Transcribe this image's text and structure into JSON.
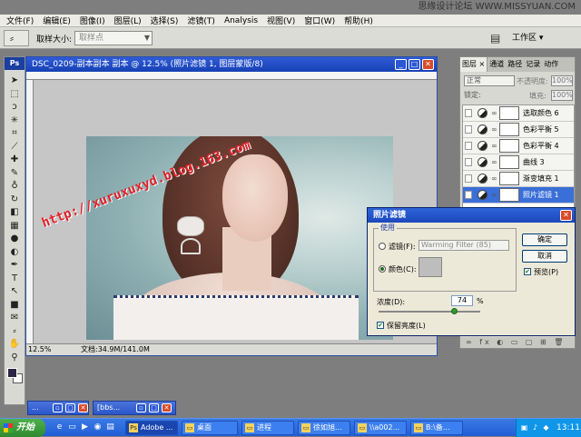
{
  "watermark_site": "思缘设计论坛 WWW.MISSYUAN.COM",
  "menubar": [
    "文件(F)",
    "编辑(E)",
    "图像(I)",
    "图层(L)",
    "选择(S)",
    "滤镜(T)",
    "Analysis",
    "视图(V)",
    "窗口(W)",
    "帮助(H)"
  ],
  "options": {
    "sample_size_label": "取样大小:",
    "sample_size_value": "取样点",
    "workspace": "工作区 ▾"
  },
  "toolbox": {
    "header": "Ps",
    "tools": [
      "move-icon",
      "marquee-icon",
      "lasso-icon",
      "magic-wand-icon",
      "crop-icon",
      "slice-icon",
      "healing-icon",
      "brush-icon",
      "stamp-icon",
      "history-brush-icon",
      "eraser-icon",
      "gradient-icon",
      "blur-icon",
      "dodge-icon",
      "pen-icon",
      "type-icon",
      "path-select-icon",
      "shape-icon",
      "notes-icon",
      "eyedropper-icon",
      "hand-icon",
      "zoom-icon"
    ],
    "glyphs": [
      "➤",
      "⬚",
      "ↄ",
      "✳",
      "⌗",
      "⟋",
      "✚",
      "✎",
      "♁",
      "↻",
      "◧",
      "▦",
      "●",
      "◐",
      "✒",
      "T",
      "↖",
      "■",
      "✉",
      "⸗",
      "✋",
      "⚲"
    ],
    "colors": {
      "foreground": "#2d2646",
      "background": "#ffffff"
    }
  },
  "document": {
    "title": "DSC_0209-副本副本 副本 @ 12.5% (照片滤镜 1, 图层蒙版/8)",
    "zoom": "12.5%",
    "doc_size": "文档:34.9M/141.0M",
    "watermark": "http://xuruxuxyd.blog.163.com"
  },
  "layers": {
    "tabs": [
      "图层 ×",
      "通道",
      "路径",
      "记录",
      "动作"
    ],
    "blend_mode": "正常",
    "opacity_label": "不透明度:",
    "opacity_value": "100%",
    "lock_label": "锁定:",
    "fill_label": "填充:",
    "fill_value": "100%",
    "rows": [
      {
        "name": "选取颜色 6",
        "active": false
      },
      {
        "name": "色彩平衡 5",
        "active": false
      },
      {
        "name": "色彩平衡 4",
        "active": false
      },
      {
        "name": "曲线 3",
        "active": false
      },
      {
        "name": "渐变填充 1",
        "active": false
      },
      {
        "name": "照片滤镜 1",
        "active": true
      }
    ],
    "footer": "∞ fx ◐ ▭ ▢ ⊞ 🗑"
  },
  "dialog": {
    "title": "照片滤镜",
    "use_label": "使用",
    "filter_label": "滤镜(F):",
    "filter_value": "Warming Filter (85)",
    "color_label": "颜色(C):",
    "color_swatch": "#bdbdbd",
    "ok": "确定",
    "cancel": "取消",
    "preview": "预览(P)",
    "density_label": "浓度(D):",
    "density_value": "74",
    "density_unit": "%",
    "density_level": 0.74,
    "preserve": "保留亮度(L)"
  },
  "minimized": [
    {
      "title": "..."
    },
    {
      "title": "[bbs..."
    }
  ],
  "taskbar": {
    "start": "开始",
    "buttons": [
      {
        "label": "Adobe ...",
        "icon": "Ps",
        "active": true
      },
      {
        "label": "桌面",
        "icon": "▭",
        "active": false
      },
      {
        "label": "进程",
        "icon": "▭",
        "active": false
      },
      {
        "label": "徐如旭...",
        "icon": "▭",
        "active": false
      },
      {
        "label": "\\\\a002...",
        "icon": "▭",
        "active": false
      },
      {
        "label": "B:\\备...",
        "icon": "▭",
        "active": false
      }
    ],
    "clock": "13:11"
  }
}
